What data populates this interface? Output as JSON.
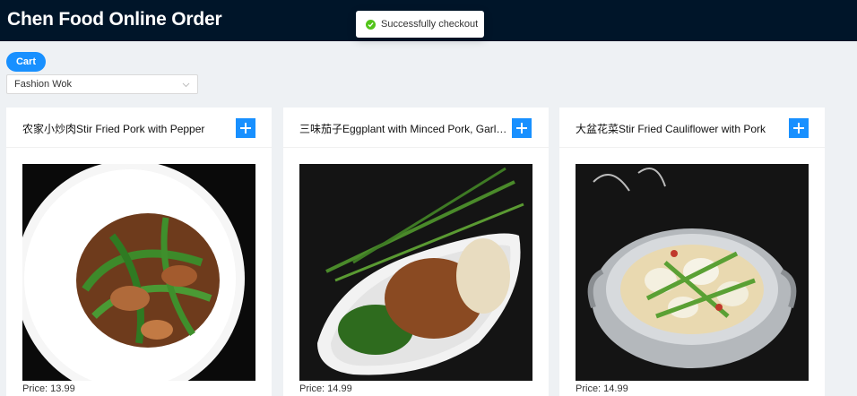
{
  "header": {
    "title": "Chen Food Online Order",
    "bg_color": "#001529"
  },
  "toast": {
    "text": "Successfully checkout",
    "icon": "check-circle-icon",
    "color": "#52c41a"
  },
  "cart_button": {
    "label": "Cart",
    "color": "#1890ff"
  },
  "restaurant_select": {
    "value": "Fashion Wok"
  },
  "menu_items": [
    {
      "title": "农家小炒肉Stir Fried Pork with Pepper",
      "price": "Price: 13.99",
      "add_icon": "plus-icon"
    },
    {
      "title": "三味茄子Eggplant with Minced Pork, Garlic, and Chives",
      "price": "Price: 14.99",
      "add_icon": "plus-icon"
    },
    {
      "title": "大盆花菜Stir Fried Cauliflower with Pork",
      "price": "Price: 14.99",
      "add_icon": "plus-icon"
    }
  ]
}
